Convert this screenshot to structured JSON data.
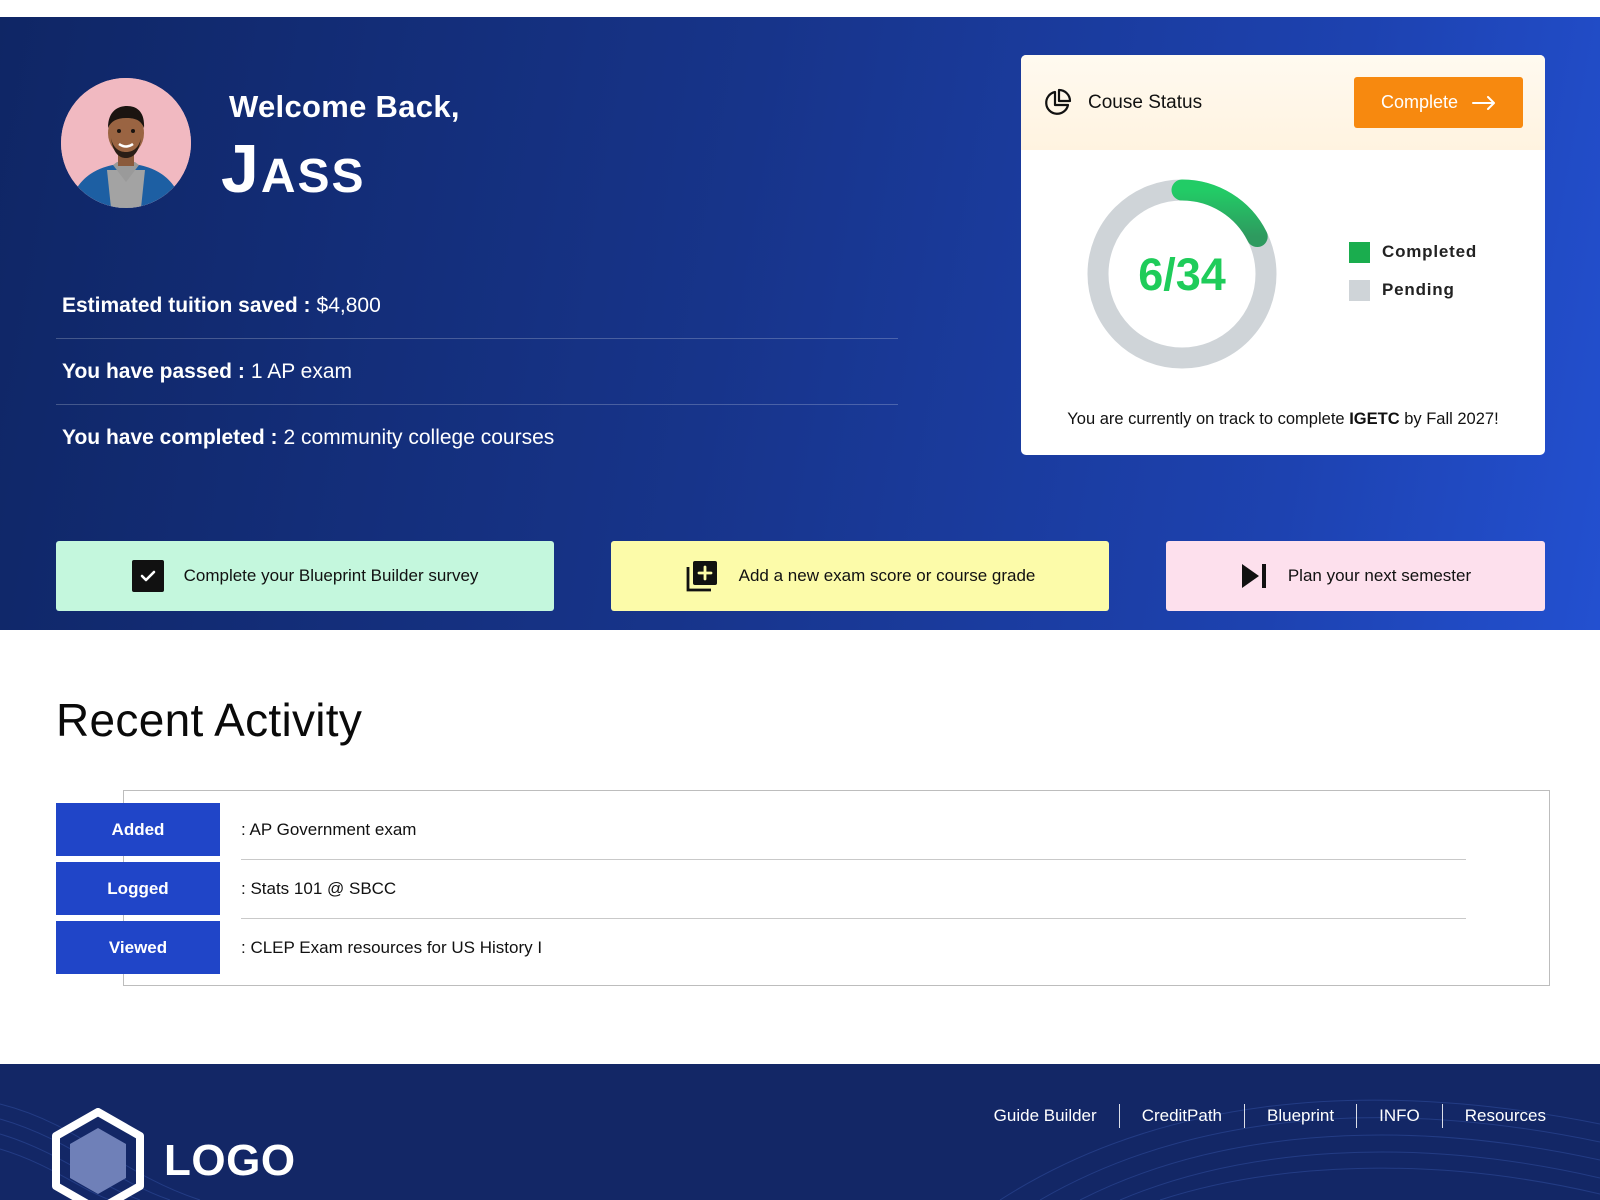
{
  "hero": {
    "welcome": "Welcome Back,",
    "name": "Jass",
    "stats": [
      {
        "label": "Estimated tuition saved :",
        "value": "$4,800"
      },
      {
        "label": "You have passed :",
        "value": "1 AP exam"
      },
      {
        "label": "You have completed :",
        "value": "2 community college courses"
      }
    ]
  },
  "status": {
    "title": "Couse Status",
    "complete_button": "Complete",
    "progress_text": "6/34",
    "completed": 6,
    "total": 34,
    "legend": {
      "completed": "Completed",
      "pending": "Pending"
    },
    "note_prefix": "You are currently on track to complete",
    "note_bold": "IGETC",
    "note_suffix": "by Fall 2027!",
    "colors": {
      "completed": "#1aad4e",
      "pending": "#cfd4d8",
      "accent": "#f7890f"
    }
  },
  "actions": [
    {
      "label": "Complete your Blueprint Builder survey",
      "icon": "checkbox-icon",
      "color": "#c4f7dd"
    },
    {
      "label": "Add a new exam score or course grade",
      "icon": "add-library-icon",
      "color": "#fcfba9"
    },
    {
      "label": "Plan your next semester",
      "icon": "skip-next-icon",
      "color": "#fde0ed"
    }
  ],
  "recent_activity": {
    "title": "Recent Activity",
    "items": [
      {
        "tag": "Added",
        "text": ": AP Government exam"
      },
      {
        "tag": "Logged",
        "text": ": Stats 101 @ SBCC"
      },
      {
        "tag": "Viewed",
        "text": ": CLEP Exam resources for US History I"
      }
    ]
  },
  "footer": {
    "logo": "LOGO",
    "nav": [
      "Guide Builder",
      "CreditPath",
      "Blueprint",
      "INFO",
      "Resources"
    ]
  }
}
